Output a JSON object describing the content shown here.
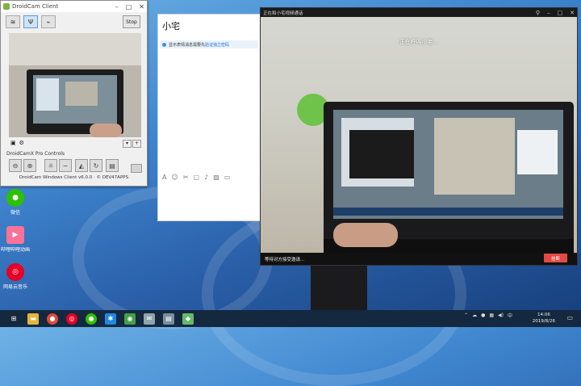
{
  "colors": {
    "accent": "#3a8ee6",
    "hangup": "#e34a43",
    "taskbar": "#14283f"
  },
  "droidcam": {
    "title": "DroidCam Client",
    "stop_label": "Stop",
    "pro_controls_label": "DroidCamX Pro Controls",
    "footer": "DroidCam Windows Client v6.0.0 · © DEV47APPS",
    "toolbar_icons": [
      "wifi-icon",
      "wifi-server-icon",
      "usb-icon"
    ],
    "pro_buttons": [
      "zoom-out-icon",
      "zoom-in-icon",
      "light-icon",
      "minus-icon",
      "contrast-icon",
      "rotate-icon",
      "save-icon"
    ]
  },
  "chat": {
    "contact_name": "小宅",
    "notice_text": "显示表情消息需要先",
    "notice_link": "验证独立密码",
    "tool_icons": [
      "font-icon",
      "emoji-icon",
      "scissors-icon",
      "screenshot-icon",
      "mic-icon",
      "image-icon",
      "folder-icon"
    ]
  },
  "video_call": {
    "title": "正在和小宅视频通话",
    "calling_text": "正在呼叫小宅...",
    "waiting_text": "等待对方接受邀请...",
    "hangup_label": "挂断"
  },
  "desktop_icons": [
    {
      "label": "微信",
      "icon": "wechat-icon",
      "color": "#2dc100"
    },
    {
      "label": "哔哩哔哩动画",
      "icon": "bilibili-icon",
      "color": "#fb7299"
    },
    {
      "label": "网易云音乐",
      "icon": "netease-music-icon",
      "color": "#e60026"
    }
  ],
  "taskbar": {
    "apps": [
      "start-icon",
      "folder-icon",
      "chrome-icon",
      "netease-music-icon",
      "wechat-icon",
      "star-icon",
      "droidcam-icon",
      "mail-icon",
      "printer-icon",
      "app-icon"
    ],
    "time": "14:06",
    "date": "2019/8/26",
    "ime": "中"
  }
}
